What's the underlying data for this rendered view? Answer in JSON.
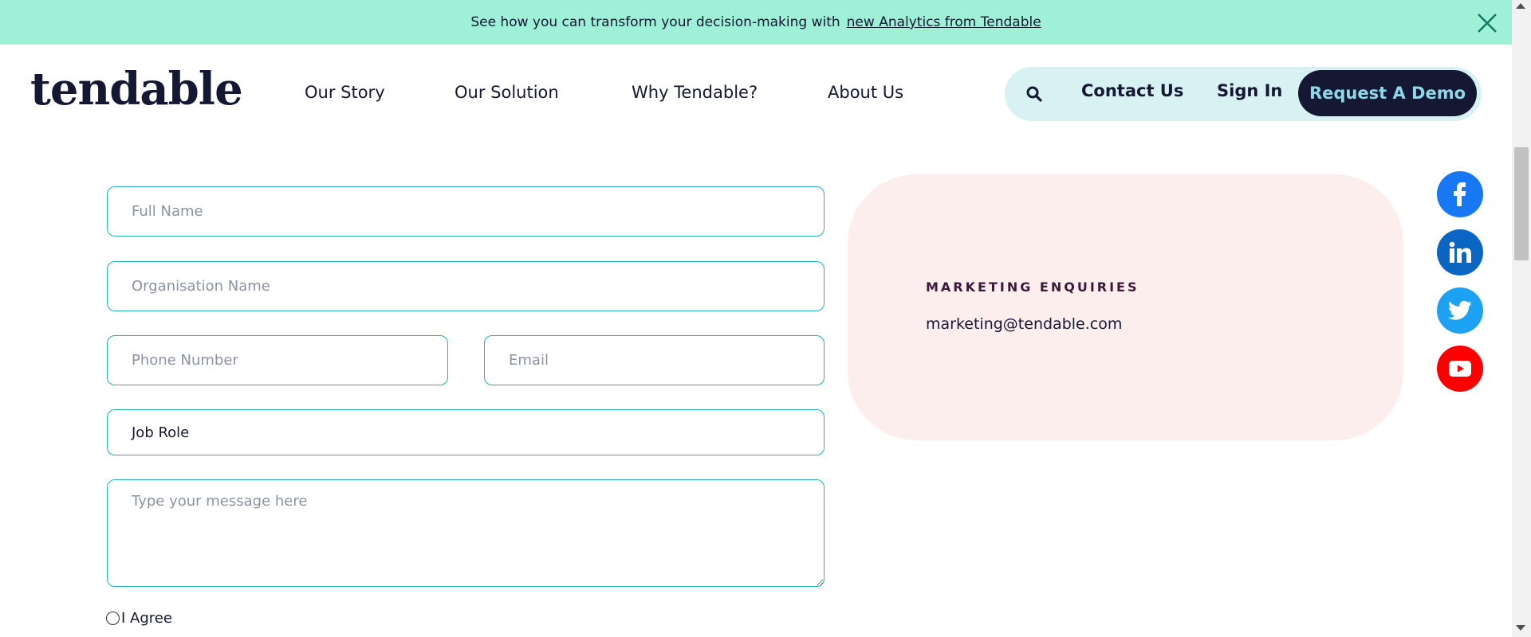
{
  "banner": {
    "text": "See how you can transform your decision-making with",
    "link": "new Analytics from Tendable",
    "close_icon": "close-icon"
  },
  "header": {
    "logo": "tendable",
    "nav": [
      "Our Story",
      "Our Solution",
      "Why Tendable?",
      "About Us"
    ],
    "search_icon": "search-icon",
    "contact": "Contact Us",
    "signin": "Sign In",
    "demo": "Request A Demo"
  },
  "form": {
    "full_name_placeholder": "Full Name",
    "org_placeholder": "Organisation Name",
    "phone_placeholder": "Phone Number",
    "email_placeholder": "Email",
    "job_role": "Job Role",
    "message_placeholder": "Type your message here",
    "agree": "I Agree"
  },
  "card": {
    "title": "MARKETING ENQUIRIES",
    "email": "marketing@tendable.com"
  },
  "social": [
    "facebook-icon",
    "linkedin-icon",
    "twitter-icon",
    "youtube-icon"
  ],
  "colors": {
    "banner": "#9ef0d6",
    "navy": "#141833",
    "teal_border": "#1fb3bd",
    "pill": "#d8f1f2",
    "card": "#fdeeee"
  }
}
